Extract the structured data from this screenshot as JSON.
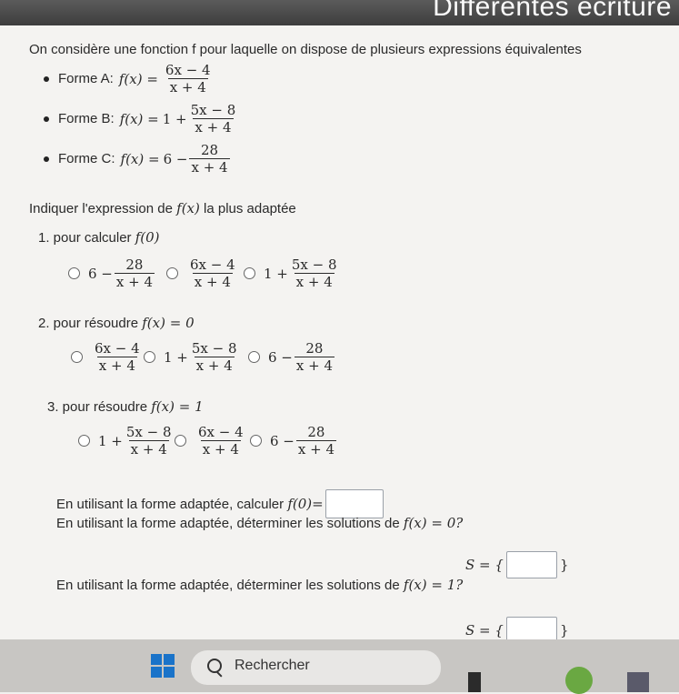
{
  "header": {
    "title": "Différentes écriture"
  },
  "intro": "On considère une fonction f pour laquelle on dispose de plusieurs expressions équivalentes",
  "forms": [
    {
      "label": "Forme A:",
      "lhs": "f(x) =",
      "prefix": "",
      "num": "6x − 4",
      "den": "x + 4"
    },
    {
      "label": "Forme B:",
      "lhs": "f(x) =",
      "prefix": "1 +",
      "num": "5x − 8",
      "den": "x + 4"
    },
    {
      "label": "Forme C:",
      "lhs": "f(x) =",
      "prefix": "6 −",
      "num": "28",
      "den": "x + 4"
    }
  ],
  "instruction": "Indiquer l'expression de",
  "instruction_fx": "f(x)",
  "instruction_tail": "la plus adaptée",
  "q1": {
    "label": "1. pour calculer",
    "expr": "f(0)",
    "options": [
      {
        "prefix": "6 −",
        "num": "28",
        "den": "x + 4"
      },
      {
        "prefix": "",
        "num": "6x − 4",
        "den": "x + 4"
      },
      {
        "prefix": "1 +",
        "num": "5x − 8",
        "den": "x + 4"
      }
    ]
  },
  "q2": {
    "label": "2. pour résoudre",
    "expr": "f(x) = 0",
    "options": [
      {
        "prefix": "",
        "num": "6x − 4",
        "den": "x + 4"
      },
      {
        "prefix": "1 +",
        "num": "5x − 8",
        "den": "x + 4"
      },
      {
        "prefix": "6 −",
        "num": "28",
        "den": "x + 4"
      }
    ]
  },
  "q3": {
    "label": "3. pour résoudre",
    "expr": "f(x) = 1",
    "options": [
      {
        "prefix": "1 +",
        "num": "5x − 8",
        "den": "x + 4"
      },
      {
        "prefix": "",
        "num": "6x − 4",
        "den": "x + 4"
      },
      {
        "prefix": "6 −",
        "num": "28",
        "den": "x + 4"
      }
    ]
  },
  "calc": {
    "text": "En utilisant la forme adaptée, calculer",
    "expr": "f(0)="
  },
  "solve0": {
    "text": "En utilisant la forme adaptée, déterminer les solutions de",
    "expr": "f(x) = 0?",
    "set_label": "S = {",
    "set_close": "}"
  },
  "solve1": {
    "text": "En utilisant la forme adaptée, déterminer les solutions de",
    "expr": "f(x) = 1?",
    "set_label": "S = {",
    "set_close": "}"
  },
  "taskbar": {
    "search_label": "Rechercher"
  }
}
